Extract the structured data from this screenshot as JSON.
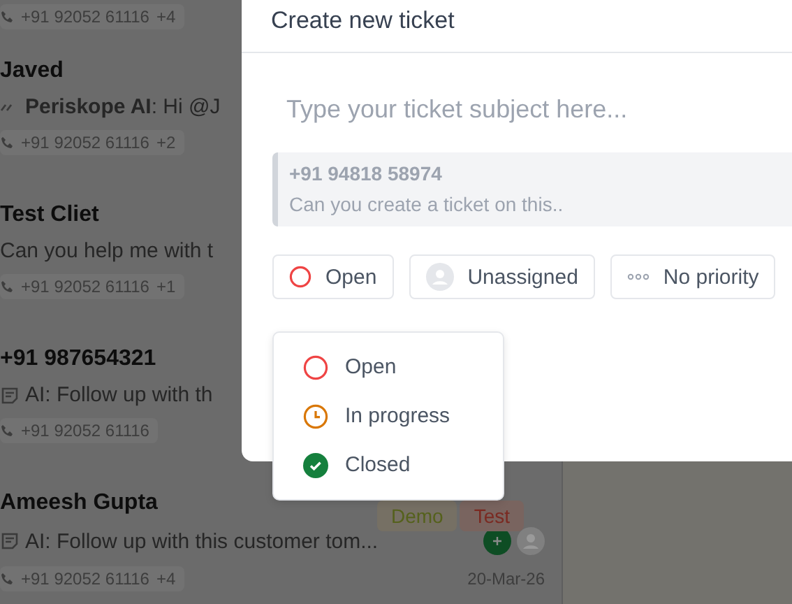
{
  "chats": [
    {
      "kind": "phone_only",
      "phone": "+91 92052 61116",
      "extra": "+4"
    },
    {
      "kind": "ai_reply",
      "name": "Javed",
      "preview_author": "Periskope AI",
      "preview": ": Hi @J",
      "phone": "+91 92052 61116",
      "extra": "+2"
    },
    {
      "kind": "message",
      "name": "Test Cliet",
      "preview": "Can you help me with t",
      "phone": "+91 92052 61116",
      "extra": "+1"
    },
    {
      "kind": "note",
      "name": "+91 987654321",
      "preview": "AI: Follow up with th",
      "phone": "+91 92052 61116"
    },
    {
      "kind": "note",
      "name": "Ameesh Gupta",
      "preview": "AI: Follow up with this customer tom...",
      "phone": "+91 92052 61116",
      "extra": "+4",
      "tags": [
        {
          "label": "Demo",
          "color": "#55611c"
        },
        {
          "label": "Test",
          "color": "#7a2a22"
        }
      ],
      "date": "20-Mar-26",
      "badges": true
    }
  ],
  "modal": {
    "title": "Create new ticket",
    "subject_placeholder": "Type your ticket subject here...",
    "quote": {
      "phone": "+91 94818 58974",
      "text": "Can you create a ticket on this.."
    },
    "chips": [
      {
        "kind": "status",
        "label": "Open"
      },
      {
        "kind": "assignee",
        "label": "Unassigned"
      },
      {
        "kind": "priority",
        "label": "No priority"
      }
    ]
  },
  "status_menu": [
    {
      "kind": "open",
      "label": "Open"
    },
    {
      "kind": "progress",
      "label": "In progress"
    },
    {
      "kind": "closed",
      "label": "Closed"
    }
  ]
}
